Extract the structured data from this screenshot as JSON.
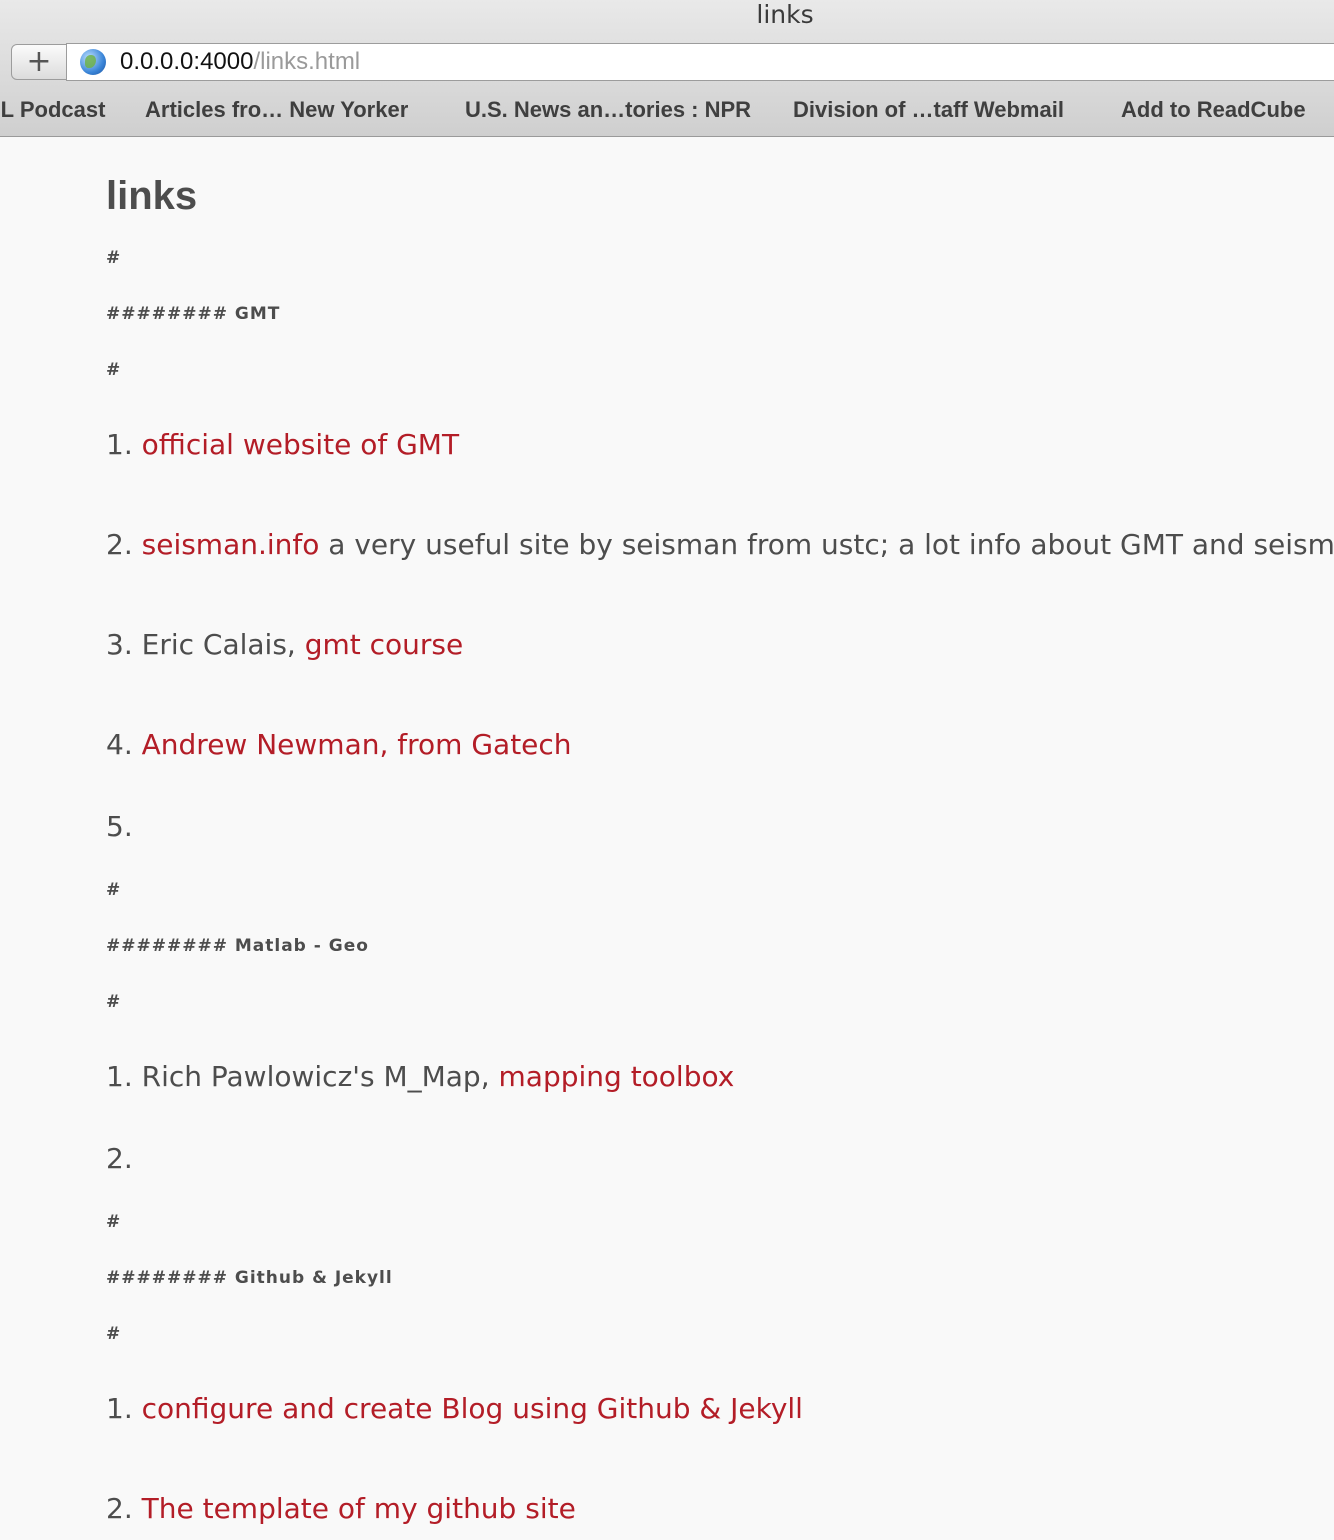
{
  "window": {
    "title": "links"
  },
  "toolbar": {
    "new_tab": "+",
    "url_host": "0.0.0.0:4000",
    "url_path": "/links.html"
  },
  "bookmarks": [
    "SL Podcast",
    "Articles fro… New Yorker",
    "U.S. News an…tories : NPR",
    "Division of …taff Webmail",
    "Add to ReadCube"
  ],
  "page": {
    "title": "links",
    "sections": [
      {
        "hash_top": "#",
        "heading": "######## GMT",
        "hash_bottom": "#",
        "items": [
          {
            "num": "1.",
            "link": "official website of GMT"
          },
          {
            "num": "2.",
            "link": "seisman.info",
            "after": " a very useful site by seisman from ustc; a lot info about GMT and seismic."
          },
          {
            "num": "3.",
            "before": "Eric Calais, ",
            "link": "gmt course"
          },
          {
            "num": "4.",
            "link": "Andrew Newman, from Gatech"
          },
          {
            "num": "5."
          }
        ]
      },
      {
        "hash_top": "#",
        "heading": "######## Matlab - Geo",
        "hash_bottom": "#",
        "items": [
          {
            "num": "1.",
            "before": "Rich Pawlowicz's M_Map, ",
            "link": "mapping toolbox"
          },
          {
            "num": "2."
          }
        ]
      },
      {
        "hash_top": "#",
        "heading": "######## Github & Jekyll",
        "hash_bottom": "#",
        "items": [
          {
            "num": "1.",
            "link": "configure and create Blog using Github & Jekyll"
          },
          {
            "num": "2.",
            "link": "The template of my github site"
          }
        ]
      }
    ]
  },
  "colors": {
    "link": "#b31d27",
    "text": "#4d4d4d",
    "background": "#f9f9f9"
  }
}
